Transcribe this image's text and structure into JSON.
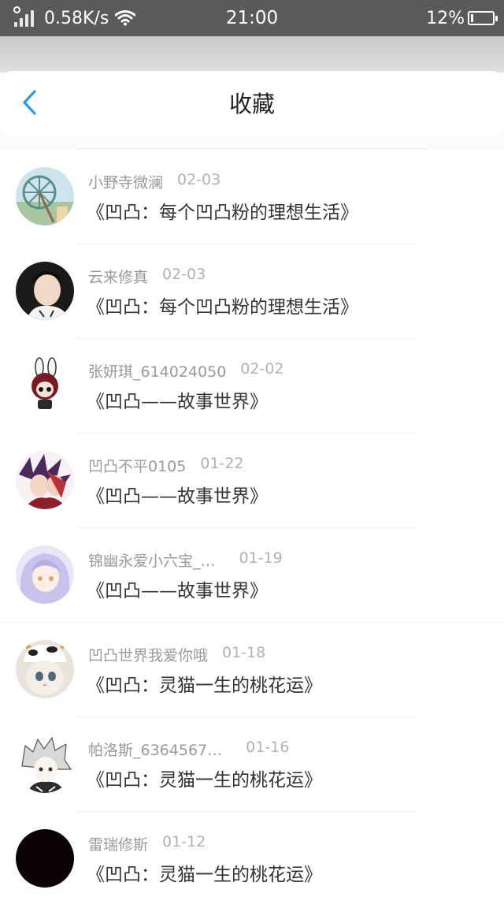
{
  "status_bar": {
    "speed": "0.58K/s",
    "time": "21:00",
    "battery": "12%",
    "battery_level": 0.12
  },
  "header": {
    "title": "收藏"
  },
  "items": [
    {
      "user": "小野寺微澜",
      "date": "02-03",
      "work": "《凹凸：每个凹凸粉的理想生活》"
    },
    {
      "user": "云来修真",
      "date": "02-03",
      "work": "《凹凸：每个凹凸粉的理想生活》"
    },
    {
      "user": "张妍琪_614024050",
      "date": "02-02",
      "work": "《凹凸——故事世界》"
    },
    {
      "user": "凹凸不平0105",
      "date": "01-22",
      "work": "《凹凸——故事世界》"
    },
    {
      "user": "锦幽永爱小六宝_…",
      "date": "01-19",
      "work": "《凹凸——故事世界》"
    },
    {
      "user": "凹凸世界我爱你哦",
      "date": "01-18",
      "work": "《凹凸：灵猫一生的桃花运》"
    },
    {
      "user": "帕洛斯_6364567…",
      "date": "01-16",
      "work": "《凹凸：灵猫一生的桃花运》"
    },
    {
      "user": "雷瑞修斯",
      "date": "01-12",
      "work": "《凹凸：灵猫一生的桃花运》"
    }
  ]
}
